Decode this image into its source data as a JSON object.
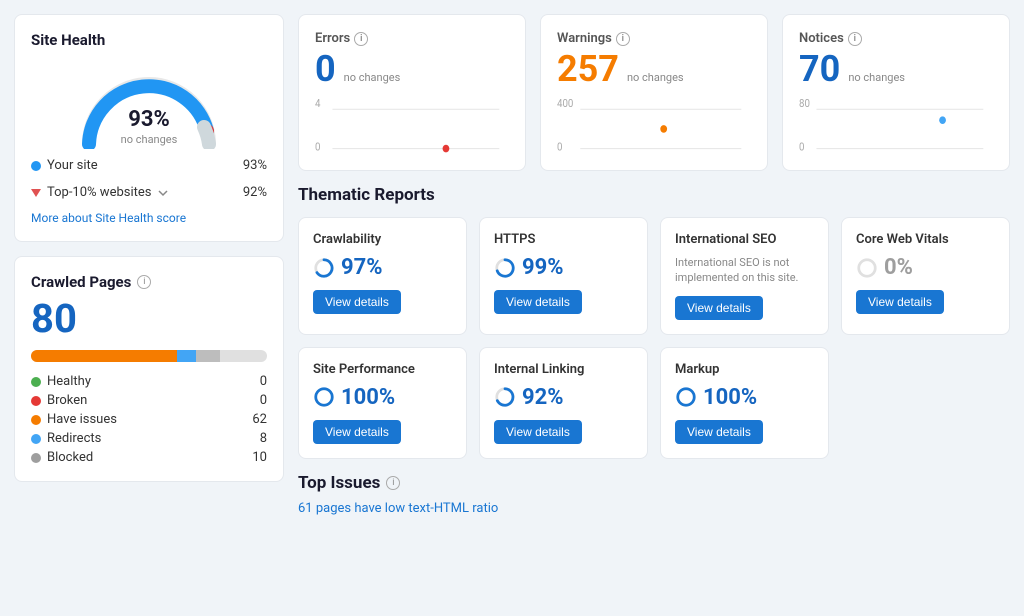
{
  "siteHealth": {
    "title": "Site Health",
    "percentage": "93%",
    "subtitle": "no changes",
    "yourSiteLabel": "Your site",
    "yourSiteValue": "93%",
    "topSitesLabel": "Top-10% websites",
    "topSitesValue": "92%",
    "moreLink": "More about Site Health score",
    "gaugeColor": "#2196f3",
    "gaugeTrackColor": "#e0e0e0",
    "gaugeFillDegrees": 167
  },
  "crawledPages": {
    "title": "Crawled Pages",
    "count": "80",
    "segments": [
      {
        "label": "Have issues",
        "color": "#f57c00",
        "width": 62
      },
      {
        "label": "Redirects",
        "color": "#42a5f5",
        "width": 8
      },
      {
        "label": "Blocked",
        "color": "#bdbdbd",
        "width": 10
      }
    ],
    "legend": [
      {
        "label": "Healthy",
        "color": "#4caf50",
        "value": "0"
      },
      {
        "label": "Broken",
        "color": "#e53935",
        "value": "0"
      },
      {
        "label": "Have issues",
        "color": "#f57c00",
        "value": "62"
      },
      {
        "label": "Redirects",
        "color": "#42a5f5",
        "value": "8"
      },
      {
        "label": "Blocked",
        "color": "#9e9e9e",
        "value": "10"
      }
    ]
  },
  "metrics": [
    {
      "label": "Errors",
      "value": "0",
      "type": "error",
      "change": "no changes",
      "maxValue": "4",
      "minValue": "0",
      "dotColor": "#e53935",
      "dotPosition": 0.7
    },
    {
      "label": "Warnings",
      "value": "257",
      "type": "warning",
      "change": "no changes",
      "maxValue": "400",
      "minValue": "0",
      "dotColor": "#f57c00",
      "dotPosition": 0.5
    },
    {
      "label": "Notices",
      "value": "70",
      "type": "notice",
      "change": "no changes",
      "maxValue": "80",
      "minValue": "0",
      "dotColor": "#42a5f5",
      "dotPosition": 0.75
    }
  ],
  "thematicReports": {
    "title": "Thematic Reports",
    "reports": [
      {
        "name": "Crawlability",
        "percentage": "97%",
        "hasDonut": true,
        "donutColor": "#1976d2",
        "showViewDetails": true,
        "viewDetailsLabel": "View details",
        "description": ""
      },
      {
        "name": "HTTPS",
        "percentage": "99%",
        "hasDonut": true,
        "donutColor": "#1976d2",
        "showViewDetails": true,
        "viewDetailsLabel": "View details",
        "description": ""
      },
      {
        "name": "International SEO",
        "percentage": "",
        "hasDonut": false,
        "donutColor": "#9e9e9e",
        "showViewDetails": true,
        "viewDetailsLabel": "View details",
        "description": "International SEO is not implemented on this site."
      },
      {
        "name": "Core Web Vitals",
        "percentage": "0%",
        "hasDonut": true,
        "donutColor": "#9e9e9e",
        "showViewDetails": true,
        "viewDetailsLabel": "View details",
        "description": ""
      },
      {
        "name": "Site Performance",
        "percentage": "100%",
        "hasDonut": true,
        "donutColor": "#1976d2",
        "showViewDetails": true,
        "viewDetailsLabel": "View details",
        "description": ""
      },
      {
        "name": "Internal Linking",
        "percentage": "92%",
        "hasDonut": true,
        "donutColor": "#1976d2",
        "showViewDetails": true,
        "viewDetailsLabel": "View details",
        "description": ""
      },
      {
        "name": "Markup",
        "percentage": "100%",
        "hasDonut": true,
        "donutColor": "#1976d2",
        "showViewDetails": true,
        "viewDetailsLabel": "View details",
        "description": ""
      }
    ]
  },
  "topIssues": {
    "title": "Top Issues",
    "issues": [
      {
        "text": "61 pages have low text-HTML ratio",
        "isLink": true
      }
    ]
  },
  "infoIconLabel": "i"
}
